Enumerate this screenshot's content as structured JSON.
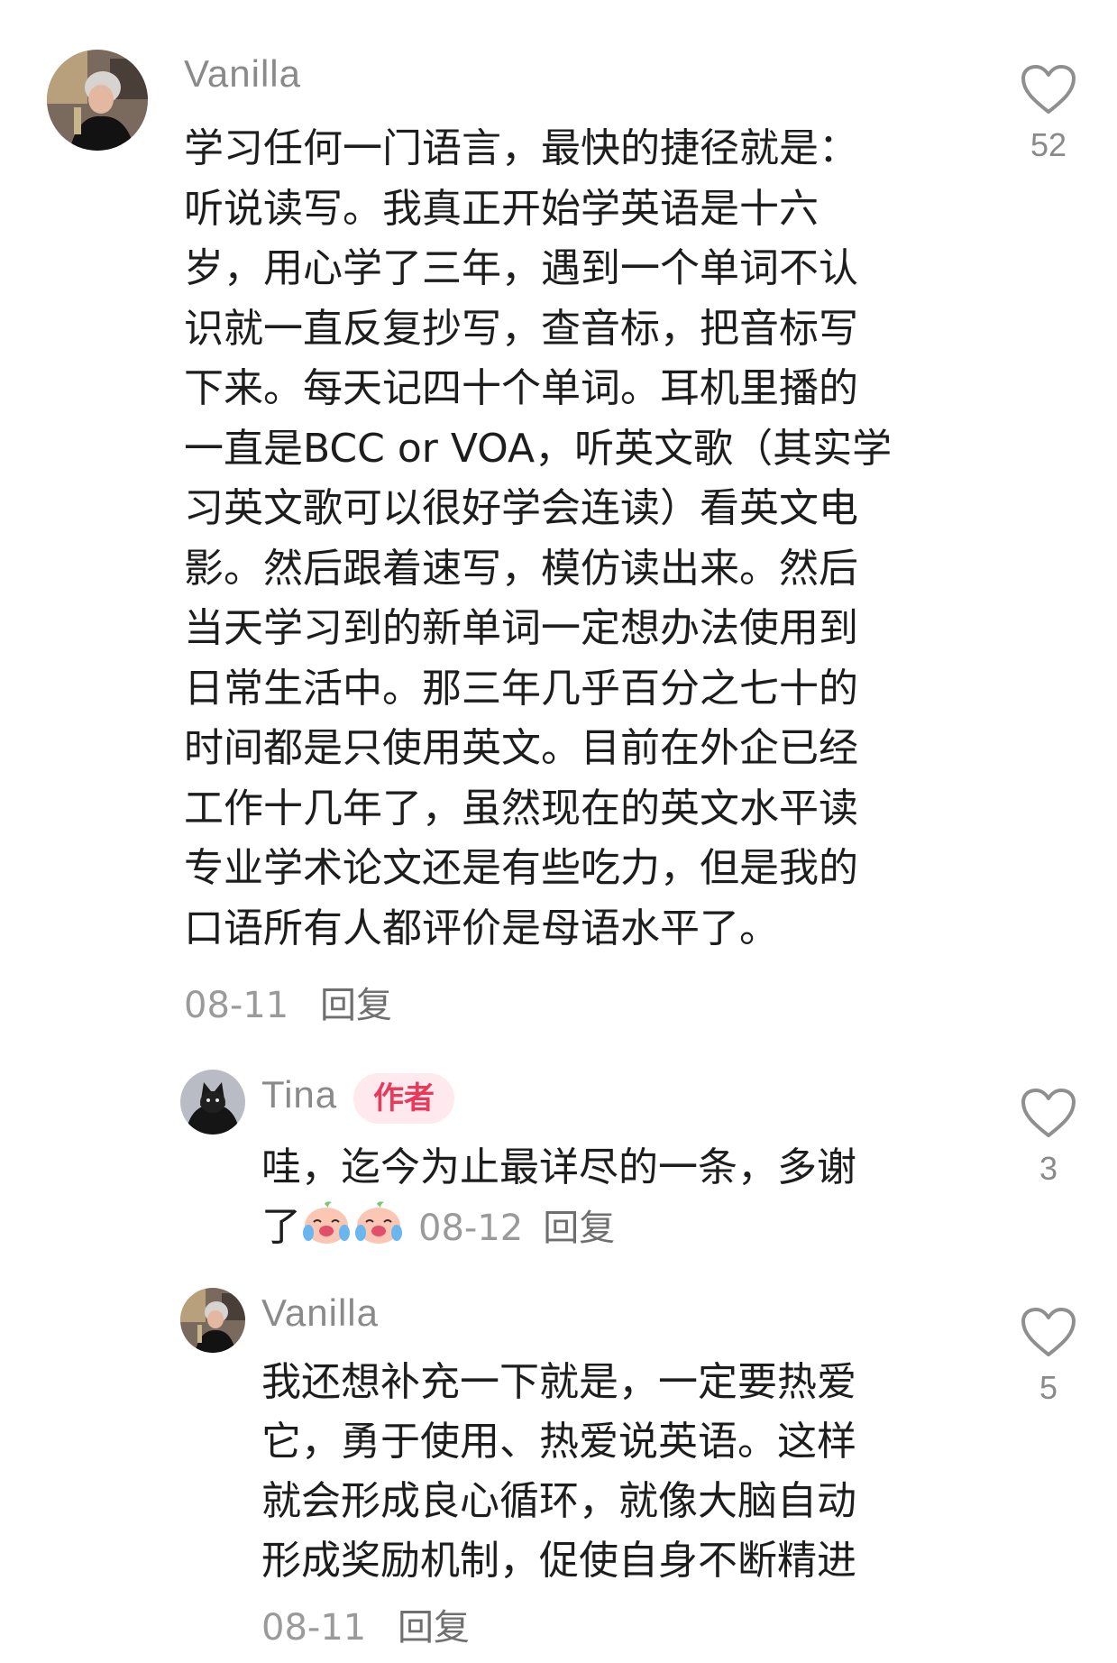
{
  "comments": [
    {
      "author": "Vanilla",
      "lines": [
        "学习任何一门语言，最快的捷径就是：",
        "听说读写。我真正开始学英语是十六",
        "岁，用心学了三年，遇到一个单词不认",
        "识就一直反复抄写，查音标，把音标写",
        "下来。每天记四十个单词。耳机里播的",
        "一直是BCC or VOA，听英文歌（其实学",
        "习英文歌可以很好学会连读）看英文电",
        "影。然后跟着速写，模仿读出来。然后",
        "当天学习到的新单词一定想办法使用到",
        "日常生活中。那三年几乎百分之七十的",
        "时间都是只使用英文。目前在外企已经",
        "工作十几年了，虽然现在的英文水平读",
        "专业学术论文还是有些吃力，但是我的",
        "口语所有人都评价是母语水平了。"
      ],
      "date": "08-11",
      "reply_label": "回复",
      "likes": "52"
    }
  ],
  "replies": [
    {
      "author": "Tina",
      "badge": "作者",
      "line1": "哇，迄今为止最详尽的一条，多谢",
      "line2": "了",
      "emoji": [
        "crying-laughing-face-emoji",
        "crying-laughing-face-emoji"
      ],
      "date": "08-12",
      "reply_label": "回复",
      "likes": "3"
    },
    {
      "author": "Vanilla",
      "lines": [
        "我还想补充一下就是，一定要热爱",
        "它，勇于使用、热爱说英语。这样",
        "就会形成良心循环，就像大脑自动",
        "形成奖励机制，促使自身不断精进"
      ],
      "date": "08-11",
      "reply_label": "回复",
      "likes": "5"
    }
  ],
  "icons": {
    "like": "heart-outline-icon"
  },
  "colors": {
    "badge_text": "#ea3a5c",
    "badge_bg": "#fde9ee",
    "meta_text": "#9a9a9a"
  }
}
